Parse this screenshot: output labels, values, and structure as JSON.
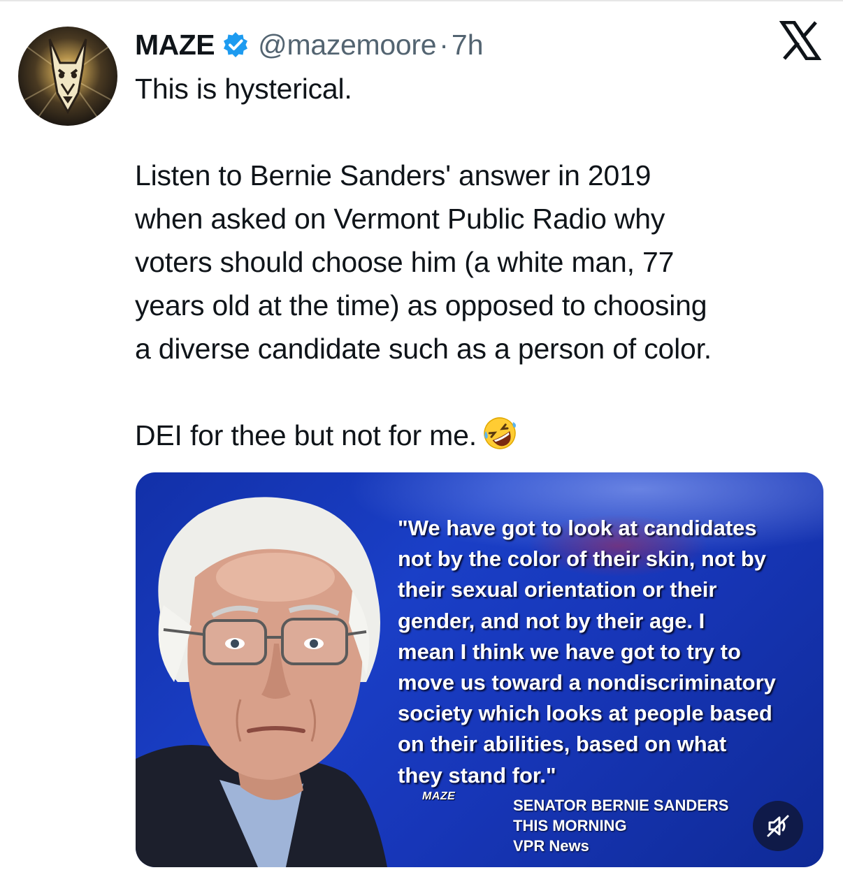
{
  "tweet": {
    "author_name": "MAZE",
    "handle": "@mazemoore",
    "separator": "·",
    "time": "7h",
    "lines": [
      "This is hysterical.",
      "",
      "Listen to Bernie Sanders' answer in 2019",
      "when asked on Vermont Public Radio why",
      "voters should choose him (a white man, 77",
      "years old at the time) as opposed to choosing",
      "a diverse candidate such as a person of color.",
      "",
      "DEI for thee but not for me."
    ],
    "emoji": "rolling-on-floor-laughing"
  },
  "icons": {
    "verified": "verified-badge-icon",
    "brand": "x-logo-icon",
    "mute": "muted-speaker-icon",
    "verified_color": "#1d9bf0"
  },
  "media": {
    "quote_lines": [
      "\"We have got to look at candidates",
      "not by the color of their skin, not by",
      "their sexual orientation or their",
      "gender, and not by their age.  I",
      "mean I think we have got to try to",
      "move us toward a nondiscriminatory",
      "society which looks at people based",
      "on their abilities, based on what",
      "they stand for.\""
    ],
    "watermark": "MAZE",
    "source_lines": [
      "SENATOR BERNIE SANDERS",
      "THIS MORNING",
      "VPR News"
    ]
  }
}
